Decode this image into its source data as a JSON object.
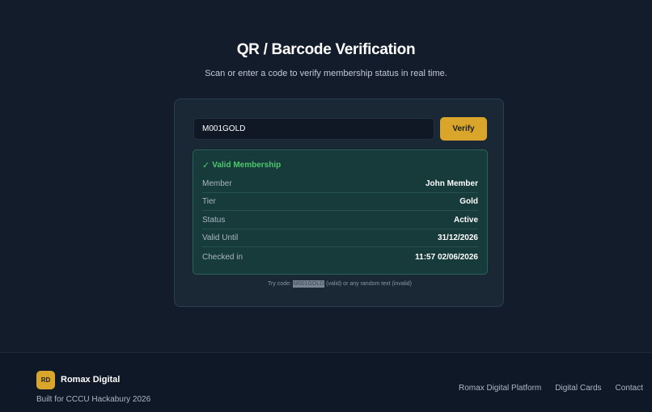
{
  "header": {
    "title": "QR / Barcode Verification",
    "subtitle": "Scan or enter a code to verify membership status in real time."
  },
  "verify_form": {
    "code_value": "M001GOLD",
    "verify_label": "Verify"
  },
  "result": {
    "check_glyph": "✓",
    "heading": "Valid Membership",
    "rows": [
      {
        "label": "Member",
        "value": "John Member"
      },
      {
        "label": "Tier",
        "value": "Gold"
      },
      {
        "label": "Status",
        "value": "Active"
      },
      {
        "label": "Valid Until",
        "value": "31/12/2026"
      },
      {
        "label": "Checked in",
        "value": "11:57 02/06/2026"
      }
    ]
  },
  "hint": {
    "prefix": "Try code: ",
    "code": "M001GOLD",
    "suffix": " (valid) or any random text (invalid)"
  },
  "footer": {
    "logo_initials": "RD",
    "brand_name": "Romax Digital",
    "tagline": "Built for CCCU Hackabury 2026",
    "links": [
      "Romax Digital Platform",
      "Digital Cards",
      "Contact"
    ]
  },
  "colors": {
    "background": "#121c2b",
    "accent": "#d9a52a",
    "success": "#4cc96e",
    "result_background": "#173a3a"
  }
}
